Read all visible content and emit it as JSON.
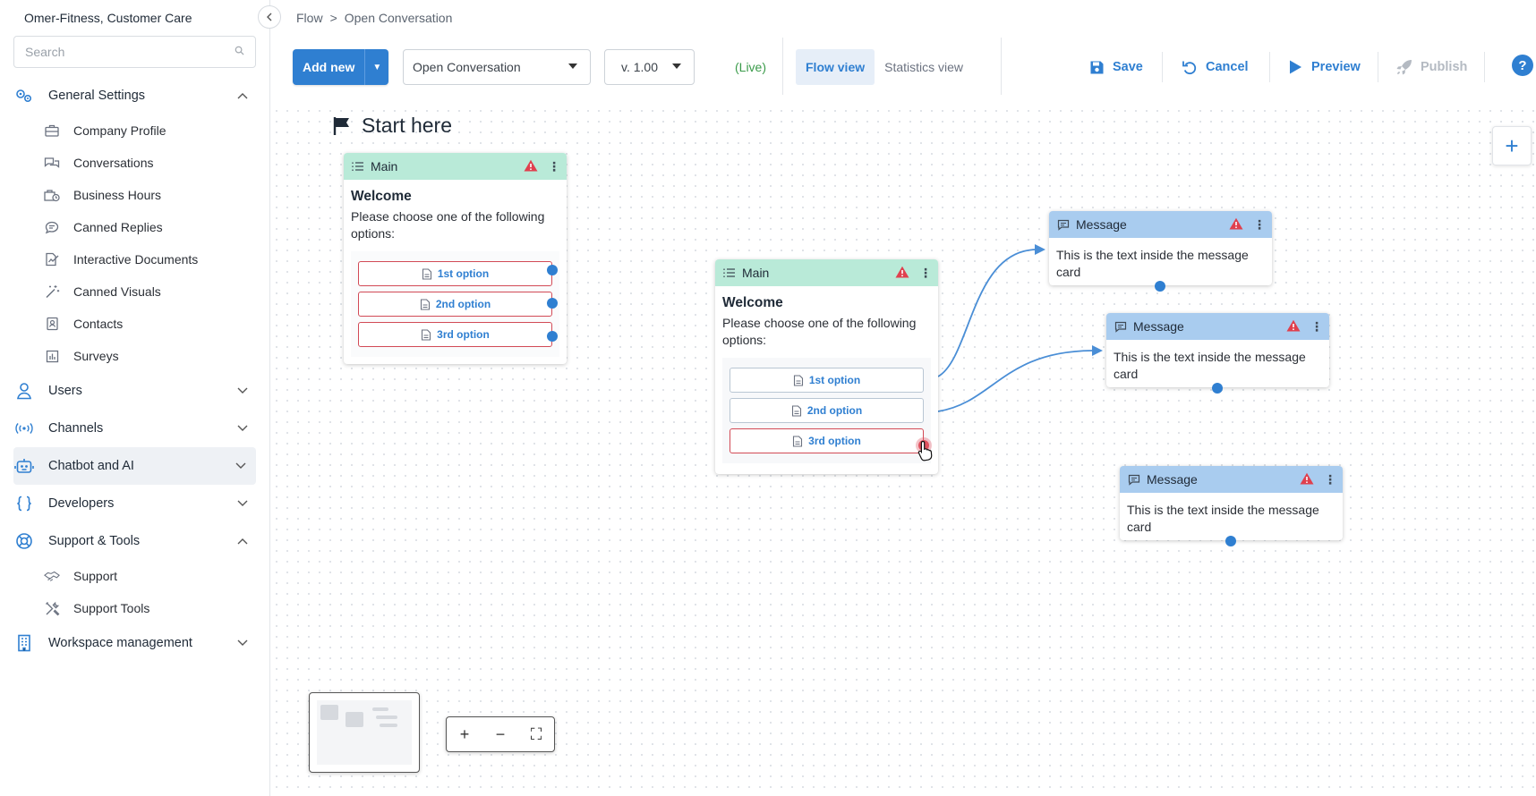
{
  "sidebar": {
    "workspace": "Omer-Fitness, Customer Care",
    "search_placeholder": "Search",
    "sections": [
      {
        "label": "General Settings",
        "icon": "gears-icon",
        "expanded": true,
        "items": [
          {
            "label": "Company Profile",
            "icon": "briefcase-icon"
          },
          {
            "label": "Conversations",
            "icon": "chat-bubbles-icon"
          },
          {
            "label": "Business Hours",
            "icon": "clock-icon"
          },
          {
            "label": "Canned Replies",
            "icon": "comment-icon"
          },
          {
            "label": "Interactive Documents",
            "icon": "document-chart-icon"
          },
          {
            "label": "Canned Visuals",
            "icon": "magic-wand-icon"
          },
          {
            "label": "Contacts",
            "icon": "contact-card-icon"
          },
          {
            "label": "Surveys",
            "icon": "bar-chart-icon"
          }
        ]
      },
      {
        "label": "Users",
        "icon": "user-icon",
        "expanded": false
      },
      {
        "label": "Channels",
        "icon": "broadcast-icon",
        "expanded": false
      },
      {
        "label": "Chatbot and AI",
        "icon": "robot-icon",
        "expanded": false,
        "active": true
      },
      {
        "label": "Developers",
        "icon": "braces-icon",
        "expanded": false
      },
      {
        "label": "Support & Tools",
        "icon": "lifebuoy-icon",
        "expanded": true,
        "items": [
          {
            "label": "Support",
            "icon": "handshake-icon"
          },
          {
            "label": "Support Tools",
            "icon": "tools-icon"
          }
        ]
      },
      {
        "label": "Workspace management",
        "icon": "building-icon",
        "expanded": false
      }
    ]
  },
  "breadcrumb": {
    "root": "Flow",
    "separator": ">",
    "current": "Open Conversation"
  },
  "toolbar": {
    "add_new": "Add new",
    "flow_select": "Open Conversation",
    "version_select": "v. 1.00",
    "status": "(Live)",
    "tabs": [
      "Flow view",
      "Statistics view"
    ],
    "active_tab": "Flow view",
    "save": "Save",
    "cancel": "Cancel",
    "preview": "Preview",
    "publish": "Publish",
    "help": "?"
  },
  "canvas": {
    "start_label": "Start here",
    "main_cards": [
      {
        "header": "Main",
        "title": "Welcome",
        "text": "Please choose one of the following options:",
        "options": [
          {
            "label": "1st option",
            "state": "error"
          },
          {
            "label": "2nd option",
            "state": "error"
          },
          {
            "label": "3rd option",
            "state": "error"
          }
        ]
      },
      {
        "header": "Main",
        "title": "Welcome",
        "text": "Please choose one of the following options:",
        "options": [
          {
            "label": "1st option",
            "state": "connected"
          },
          {
            "label": "2nd option",
            "state": "connected"
          },
          {
            "label": "3rd option",
            "state": "error"
          }
        ]
      }
    ],
    "message_cards": [
      {
        "header": "Message",
        "text": "This is the text inside the message card"
      },
      {
        "header": "Message",
        "text": "This is the text inside the message card"
      },
      {
        "header": "Message",
        "text": "This is the text inside the message card"
      }
    ],
    "zoom_controls": {
      "in": "+",
      "out": "−",
      "fit": "⛶"
    }
  },
  "colors": {
    "accent": "#2f7fd1",
    "main_header": "#b9ead8",
    "message_header": "#a9ccef",
    "error": "#d24a56",
    "live": "#3a9b4a"
  }
}
